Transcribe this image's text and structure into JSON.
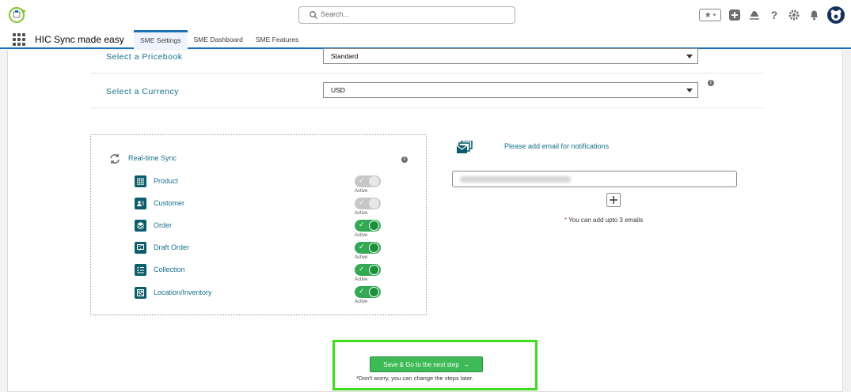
{
  "header": {
    "search_placeholder": "Search..."
  },
  "appnav": {
    "app_name": "HIC Sync made easy",
    "tabs": [
      {
        "label": "SME Settings"
      },
      {
        "label": "SME Dashboard"
      },
      {
        "label": "SME Features"
      }
    ]
  },
  "form": {
    "pricebook_label": "Select a Pricebook",
    "pricebook_value": "Standard",
    "currency_label": "Select a Currency",
    "currency_value": "USD"
  },
  "sync": {
    "title": "Real-time Sync",
    "items": [
      {
        "label": "Product",
        "status": "Active",
        "enabled": false
      },
      {
        "label": "Customer",
        "status": "Active",
        "enabled": false
      },
      {
        "label": "Order",
        "status": "Active",
        "enabled": true
      },
      {
        "label": "Draft Order",
        "status": "Active",
        "enabled": true
      },
      {
        "label": "Collection",
        "status": "Active",
        "enabled": true
      },
      {
        "label": "Location/Inventory",
        "status": "Active",
        "enabled": true
      }
    ]
  },
  "notifications": {
    "title": "Please add email for notifications",
    "note": "You can add upto 3 emails",
    "required_mark": "*"
  },
  "footer": {
    "save_label": "Save & Go to the next step",
    "save_arrow": "→",
    "note": "*Don't worry, you can change the steps later."
  },
  "colors": {
    "accent": "#1b6fb5",
    "label": "#16708c",
    "toggle_on": "#34a853",
    "save": "#3ebb57",
    "highlight": "#3ddc1f"
  }
}
